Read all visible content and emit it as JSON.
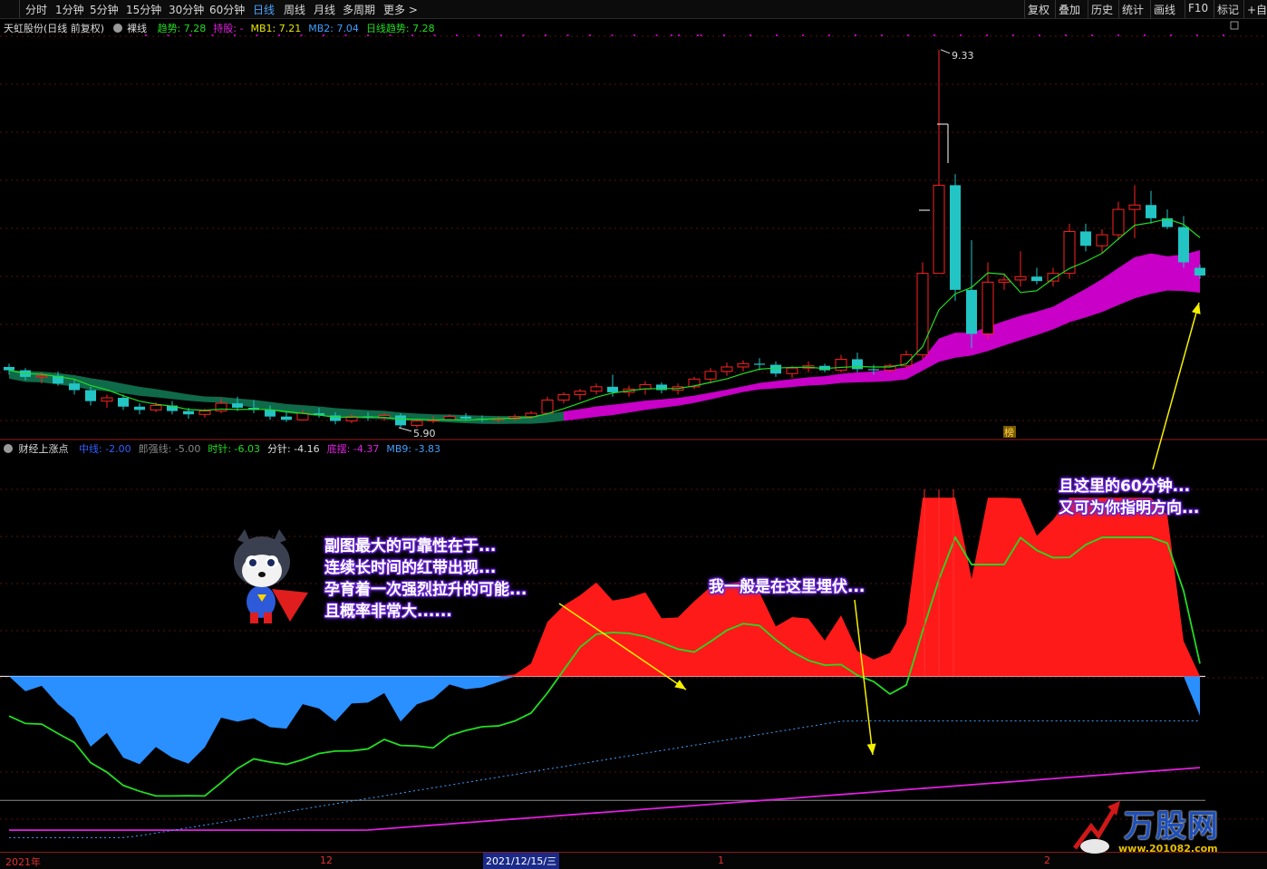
{
  "toolbar": {
    "periods": [
      "分时",
      "1分钟",
      "5分钟",
      "15分钟",
      "30分钟",
      "60分钟",
      "日线",
      "周线",
      "月线",
      "多周期",
      "更多 >"
    ],
    "active_period": "日线",
    "tools": [
      "复权",
      "叠加",
      "历史",
      "统计",
      "画线",
      "F10",
      "标记",
      "+自选"
    ]
  },
  "main_panel": {
    "title": "天虹股份(日线 前复权)",
    "indicator": "裸线",
    "legend": [
      {
        "label": "趋势:",
        "value": "7.28",
        "color": "#22dd22"
      },
      {
        "label": "持股:",
        "value": "-",
        "color": "#e020e0"
      },
      {
        "label": "MB1:",
        "value": "7.21",
        "color": "#e8e800"
      },
      {
        "label": "MB2:",
        "value": "7.04",
        "color": "#3fa0ff"
      },
      {
        "label": "日线趋势:",
        "value": "7.28",
        "color": "#22dd22"
      }
    ],
    "high_label": "9.33",
    "low_label": "5.90",
    "badge": "榜"
  },
  "sub_panel": {
    "title": "财经上涨点",
    "legend": [
      {
        "label": "中线:",
        "value": "-2.00",
        "color": "#3060ff"
      },
      {
        "label": "郎强线:",
        "value": "-5.00",
        "color": "#888888"
      },
      {
        "label": "时针:",
        "value": "-6.03",
        "color": "#22dd22"
      },
      {
        "label": "分针:",
        "value": "-4.16",
        "color": "#dddddd"
      },
      {
        "label": "底摆:",
        "value": "-4.37",
        "color": "#e020e0"
      },
      {
        "label": "MB9:",
        "value": "-3.83",
        "color": "#3fa0ff"
      }
    ]
  },
  "x_axis": {
    "labels": [
      "2021年",
      "12",
      "2021/12/15/三",
      "1",
      "2"
    ]
  },
  "callouts": {
    "top_right": [
      "且这里的60分钟...",
      "又可为你指明方向..."
    ],
    "middle_left": [
      "副图最大的可靠性在于...",
      "连续长时间的红带出现...",
      "孕育着一次强烈拉升的可能...",
      "且概率非常大......"
    ],
    "middle": [
      "我一般是在这里埋伏..."
    ]
  },
  "watermark": {
    "name": "万股网",
    "url": "www.201082.com"
  },
  "colors": {
    "up": "#ff2222",
    "down": "#22c4c4",
    "trend": "#22dd22",
    "band": "#c800c8",
    "hist_pos": "#ff1a1a",
    "hist_neg": "#2a8fff"
  },
  "chart_data": {
    "type": "candlestick",
    "candles_ohlc": [
      [
        6.45,
        6.48,
        6.38,
        6.42
      ],
      [
        6.42,
        6.44,
        6.33,
        6.36
      ],
      [
        6.36,
        6.4,
        6.3,
        6.37
      ],
      [
        6.37,
        6.41,
        6.28,
        6.3
      ],
      [
        6.3,
        6.34,
        6.2,
        6.24
      ],
      [
        6.24,
        6.27,
        6.1,
        6.14
      ],
      [
        6.14,
        6.2,
        6.08,
        6.17
      ],
      [
        6.17,
        6.2,
        6.06,
        6.09
      ],
      [
        6.09,
        6.12,
        6.02,
        6.06
      ],
      [
        6.06,
        6.13,
        6.04,
        6.1
      ],
      [
        6.1,
        6.14,
        6.02,
        6.05
      ],
      [
        6.05,
        6.08,
        5.98,
        6.02
      ],
      [
        6.02,
        6.07,
        5.99,
        6.05
      ],
      [
        6.05,
        6.16,
        6.03,
        6.12
      ],
      [
        6.12,
        6.18,
        6.05,
        6.08
      ],
      [
        6.08,
        6.15,
        6.03,
        6.06
      ],
      [
        6.06,
        6.1,
        5.97,
        6.0
      ],
      [
        6.0,
        6.04,
        5.95,
        5.97
      ],
      [
        5.97,
        6.06,
        5.96,
        6.03
      ],
      [
        6.03,
        6.08,
        5.99,
        6.01
      ],
      [
        6.01,
        6.04,
        5.93,
        5.96
      ],
      [
        5.96,
        6.02,
        5.94,
        6.0
      ],
      [
        6.0,
        6.04,
        5.96,
        5.99
      ],
      [
        5.99,
        6.03,
        5.96,
        6.01
      ],
      [
        6.01,
        6.03,
        5.9,
        5.92
      ],
      [
        5.92,
        5.98,
        5.9,
        5.96
      ],
      [
        5.96,
        6.0,
        5.94,
        5.97
      ],
      [
        5.97,
        6.02,
        5.96,
        6.0
      ],
      [
        6.0,
        6.03,
        5.96,
        5.98
      ],
      [
        5.98,
        6.01,
        5.95,
        5.97
      ],
      [
        5.97,
        6.0,
        5.95,
        5.98
      ],
      [
        5.98,
        6.02,
        5.96,
        6.0
      ],
      [
        6.0,
        6.05,
        5.98,
        6.03
      ],
      [
        6.03,
        6.18,
        6.02,
        6.15
      ],
      [
        6.15,
        6.22,
        6.12,
        6.2
      ],
      [
        6.2,
        6.25,
        6.15,
        6.23
      ],
      [
        6.23,
        6.3,
        6.2,
        6.27
      ],
      [
        6.27,
        6.38,
        6.18,
        6.22
      ],
      [
        6.22,
        6.28,
        6.18,
        6.25
      ],
      [
        6.25,
        6.32,
        6.2,
        6.29
      ],
      [
        6.29,
        6.31,
        6.21,
        6.24
      ],
      [
        6.24,
        6.3,
        6.2,
        6.27
      ],
      [
        6.27,
        6.36,
        6.25,
        6.34
      ],
      [
        6.34,
        6.44,
        6.3,
        6.41
      ],
      [
        6.41,
        6.49,
        6.37,
        6.45
      ],
      [
        6.45,
        6.51,
        6.41,
        6.48
      ],
      [
        6.48,
        6.53,
        6.42,
        6.47
      ],
      [
        6.47,
        6.5,
        6.36,
        6.39
      ],
      [
        6.39,
        6.46,
        6.35,
        6.44
      ],
      [
        6.44,
        6.5,
        6.4,
        6.46
      ],
      [
        6.46,
        6.48,
        6.4,
        6.42
      ],
      [
        6.42,
        6.56,
        6.4,
        6.52
      ],
      [
        6.52,
        6.58,
        6.4,
        6.43
      ],
      [
        6.43,
        6.47,
        6.38,
        6.42
      ],
      [
        6.42,
        6.48,
        6.4,
        6.46
      ],
      [
        6.46,
        6.6,
        6.44,
        6.56
      ],
      [
        6.56,
        7.4,
        6.52,
        7.3
      ],
      [
        7.3,
        9.33,
        7.6,
        8.1
      ],
      [
        8.1,
        8.2,
        7.05,
        7.15
      ],
      [
        7.15,
        7.6,
        6.62,
        6.75
      ],
      [
        6.75,
        7.4,
        6.7,
        7.22
      ],
      [
        7.22,
        7.3,
        7.15,
        7.24
      ],
      [
        7.24,
        7.5,
        7.18,
        7.27
      ],
      [
        7.27,
        7.35,
        7.2,
        7.23
      ],
      [
        7.23,
        7.35,
        7.18,
        7.3
      ],
      [
        7.3,
        7.75,
        7.25,
        7.68
      ],
      [
        7.68,
        7.75,
        7.5,
        7.55
      ],
      [
        7.55,
        7.7,
        7.48,
        7.65
      ],
      [
        7.65,
        7.95,
        7.6,
        7.88
      ],
      [
        7.88,
        8.1,
        7.62,
        7.92
      ],
      [
        7.92,
        8.05,
        7.75,
        7.8
      ],
      [
        7.8,
        7.88,
        7.7,
        7.72
      ],
      [
        7.72,
        7.82,
        7.35,
        7.4
      ],
      [
        7.35,
        7.38,
        7.25,
        7.28
      ]
    ],
    "y_range": [
      5.8,
      9.6
    ],
    "sub_y_range": [
      -7.0,
      9.0
    ]
  }
}
